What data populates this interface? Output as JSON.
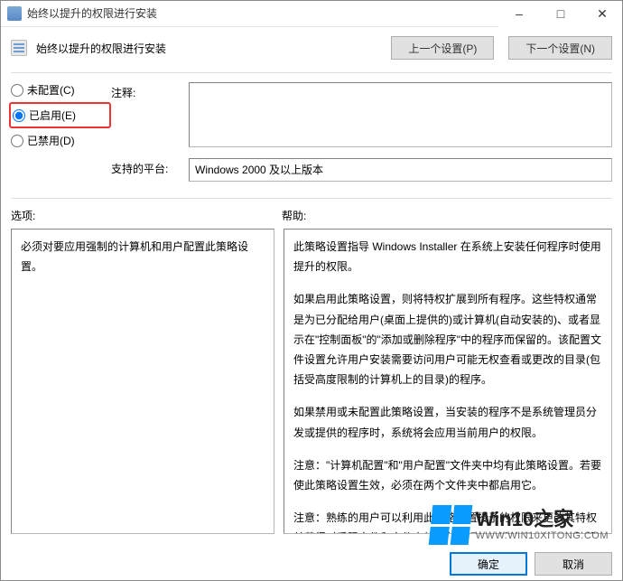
{
  "titlebar": {
    "title": "始终以提升的权限进行安装"
  },
  "header": {
    "title": "始终以提升的权限进行安装",
    "prev_btn": "上一个设置(P)",
    "next_btn": "下一个设置(N)"
  },
  "radios": {
    "not_configured": "未配置(C)",
    "enabled": "已启用(E)",
    "disabled": "已禁用(D)",
    "selected": "enabled"
  },
  "fields": {
    "comment_label": "注释:",
    "comment_value": "",
    "platform_label": "支持的平台:",
    "platform_value": "Windows 2000 及以上版本"
  },
  "sections": {
    "options_label": "选项:",
    "help_label": "帮助:"
  },
  "options_text": "必须对要应用强制的计算机和用户配置此策略设置。",
  "help_paragraphs": [
    "此策略设置指导 Windows Installer 在系统上安装任何程序时使用提升的权限。",
    "如果启用此策略设置，则将特权扩展到所有程序。这些特权通常是为已分配给用户(桌面上提供的)或计算机(自动安装的)、或者显示在\"控制面板\"的\"添加或删除程序\"中的程序而保留的。该配置文件设置允许用户安装需要访问用户可能无权查看或更改的目录(包括受高度限制的计算机上的目录)的程序。",
    "如果禁用或未配置此策略设置，当安装的程序不是系统管理员分发或提供的程序时，系统将会应用当前用户的权限。",
    "注意：\"计算机配置\"和\"用户配置\"文件夹中均有此策略设置。若要使此策略设置生效，必须在两个文件夹中都启用它。",
    "注意：熟练的用户可以利用此策略设置授予的权限来更改其特权并获得对受限文件和文件夹的永久访问权。请注意，这个策略设置的\"用户配置\"版本不一定安全。"
  ],
  "buttons": {
    "ok": "确定",
    "cancel": "取消"
  },
  "watermark": {
    "text_big": "Win10之家",
    "text_small": "WWW.WIN10XITONG.COM"
  }
}
